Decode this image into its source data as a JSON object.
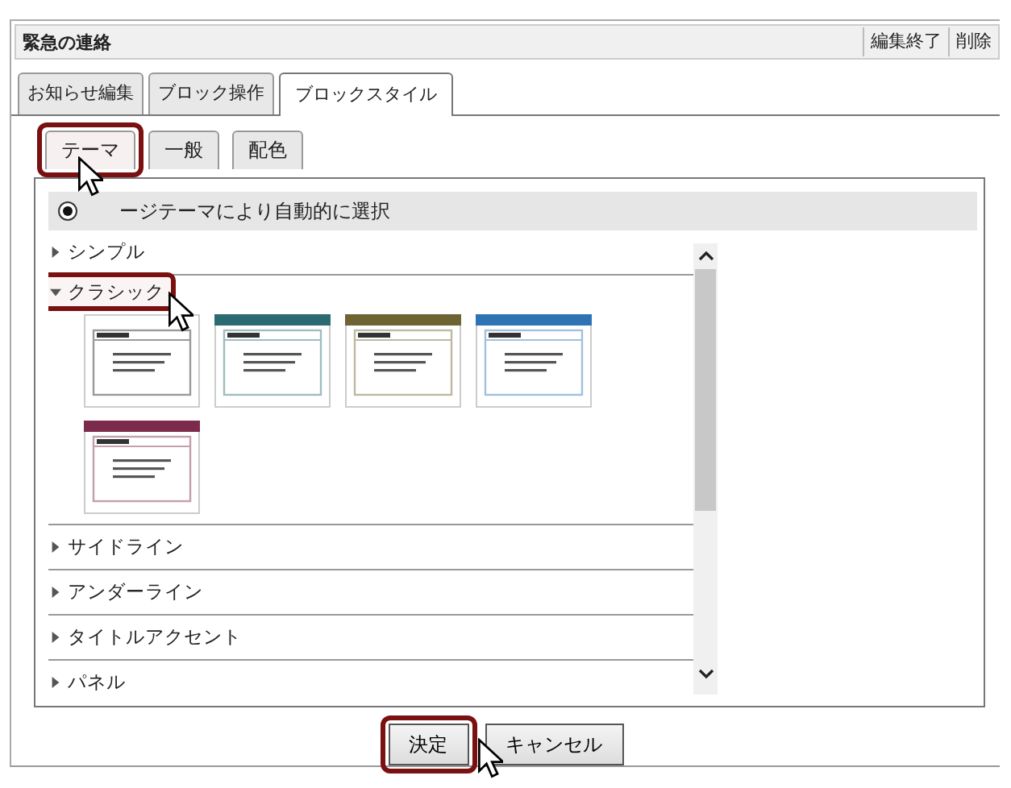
{
  "panel": {
    "title": "緊急の連絡",
    "actions": [
      "編集終了",
      "削除"
    ]
  },
  "tabs": [
    {
      "label": "お知らせ編集",
      "selected": false
    },
    {
      "label": "ブロック操作",
      "selected": false
    },
    {
      "label": "ブロックスタイル",
      "selected": true
    }
  ],
  "subtabs": [
    {
      "label": "テーマ",
      "selected": true,
      "highlighted": true
    },
    {
      "label": "一般",
      "selected": false,
      "highlighted": false
    },
    {
      "label": "配色",
      "selected": false,
      "highlighted": false
    }
  ],
  "auto_option": {
    "label": "ージテーマにより自動的に選択",
    "checked": true
  },
  "sections": [
    {
      "label": "シンプル",
      "expanded": false,
      "highlighted": false
    },
    {
      "label": "クラシック",
      "expanded": true,
      "highlighted": true,
      "themes": [
        {
          "kind": "plain",
          "color": "#9a9a9a"
        },
        {
          "kind": "banner",
          "color": "#2c6a72"
        },
        {
          "kind": "banner",
          "color": "#6e6332"
        },
        {
          "kind": "banner",
          "color": "#2e74b5"
        },
        {
          "kind": "banner",
          "color": "#7c2b4c"
        }
      ]
    },
    {
      "label": "サイドライン",
      "expanded": false,
      "highlighted": false
    },
    {
      "label": "アンダーライン",
      "expanded": false,
      "highlighted": false
    },
    {
      "label": "タイトルアクセント",
      "expanded": false,
      "highlighted": false
    },
    {
      "label": "パネル",
      "expanded": false,
      "highlighted": false
    }
  ],
  "buttons": [
    {
      "label": "決定",
      "highlighted": true
    },
    {
      "label": "キャンセル",
      "highlighted": false
    }
  ]
}
